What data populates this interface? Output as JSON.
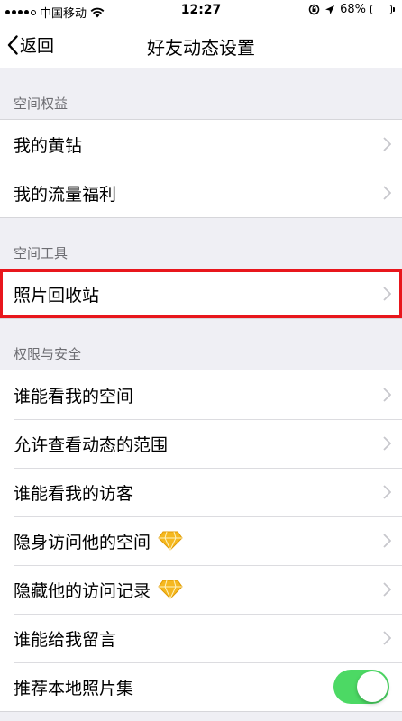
{
  "status_bar": {
    "carrier": "中国移动",
    "time": "12:27",
    "battery": "68%",
    "battery_level": 0.68
  },
  "nav": {
    "back_label": "返回",
    "title": "好友动态设置"
  },
  "sections": [
    {
      "header": "空间权益",
      "items": [
        {
          "label": "我的黄钻"
        },
        {
          "label": "我的流量福利"
        }
      ]
    },
    {
      "header": "空间工具",
      "items": [
        {
          "label": "照片回收站"
        }
      ]
    },
    {
      "header": "权限与安全",
      "items": [
        {
          "label": "谁能看我的空间"
        },
        {
          "label": "允许查看动态的范围"
        },
        {
          "label": "谁能看我的访客"
        },
        {
          "label": "隐身访问他的空间",
          "icon": "yellow-diamond-icon"
        },
        {
          "label": "隐藏他的访问记录",
          "icon": "yellow-diamond-icon"
        },
        {
          "label": "谁能给我留言"
        },
        {
          "label": "推荐本地照片集",
          "toggle": "on"
        }
      ]
    }
  ],
  "colors": {
    "highlight": "#e8161c",
    "toggle_on": "#4cd964",
    "background": "#efeff4",
    "section_text": "#6d6d72"
  }
}
